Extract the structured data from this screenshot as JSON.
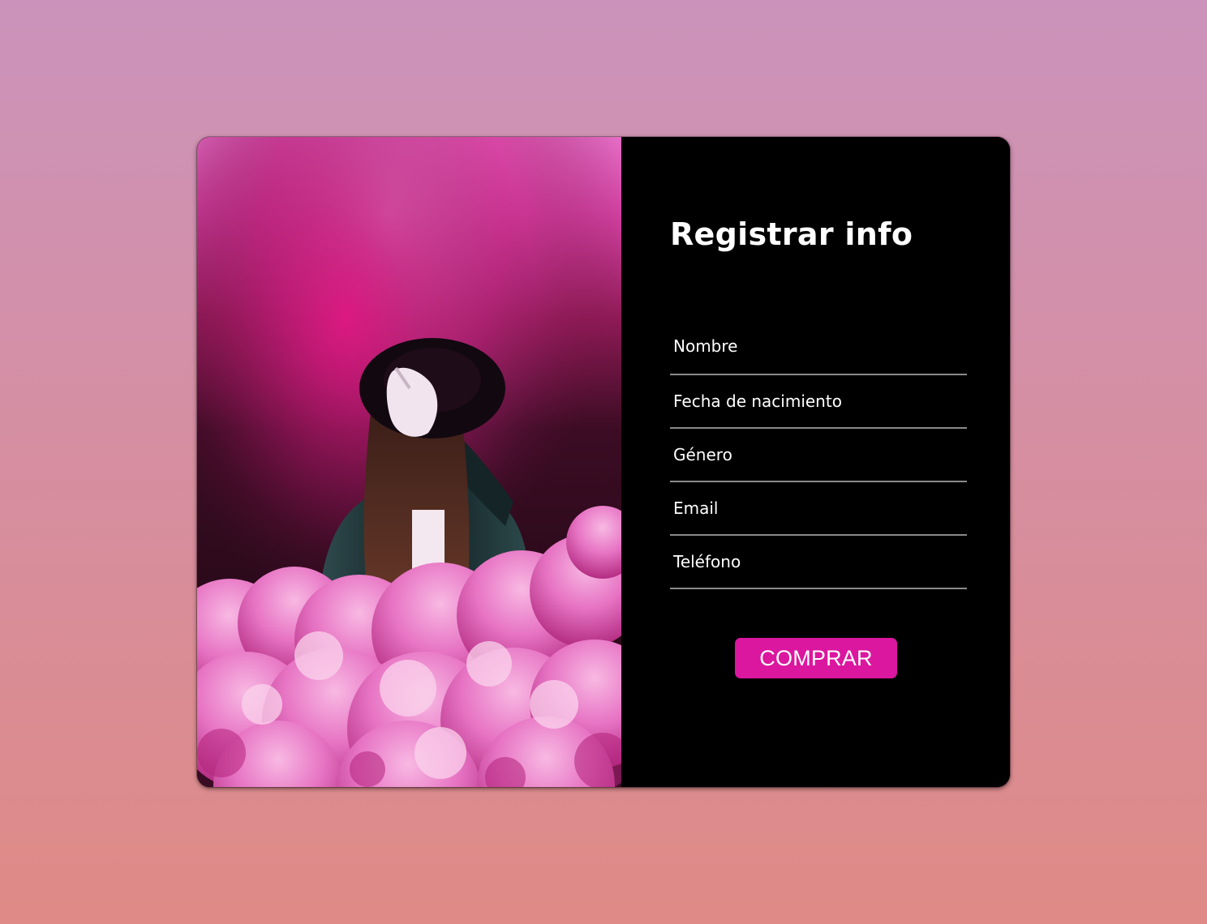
{
  "form": {
    "title": "Registrar info",
    "fields": [
      {
        "placeholder": "Nombre"
      },
      {
        "placeholder": "Fecha de nacimiento"
      },
      {
        "placeholder": "Género"
      },
      {
        "placeholder": "Email"
      },
      {
        "placeholder": "Teléfono"
      }
    ],
    "submit_label": "COMPRAR"
  },
  "colors": {
    "background_top": "#cb93bb",
    "background_bottom": "#df8a86",
    "panel": "#000000",
    "button": "#db169f",
    "field_underline": "#8a8a8a"
  },
  "hero_image": {
    "subject": "person-in-hat-with-pink-smoke"
  }
}
